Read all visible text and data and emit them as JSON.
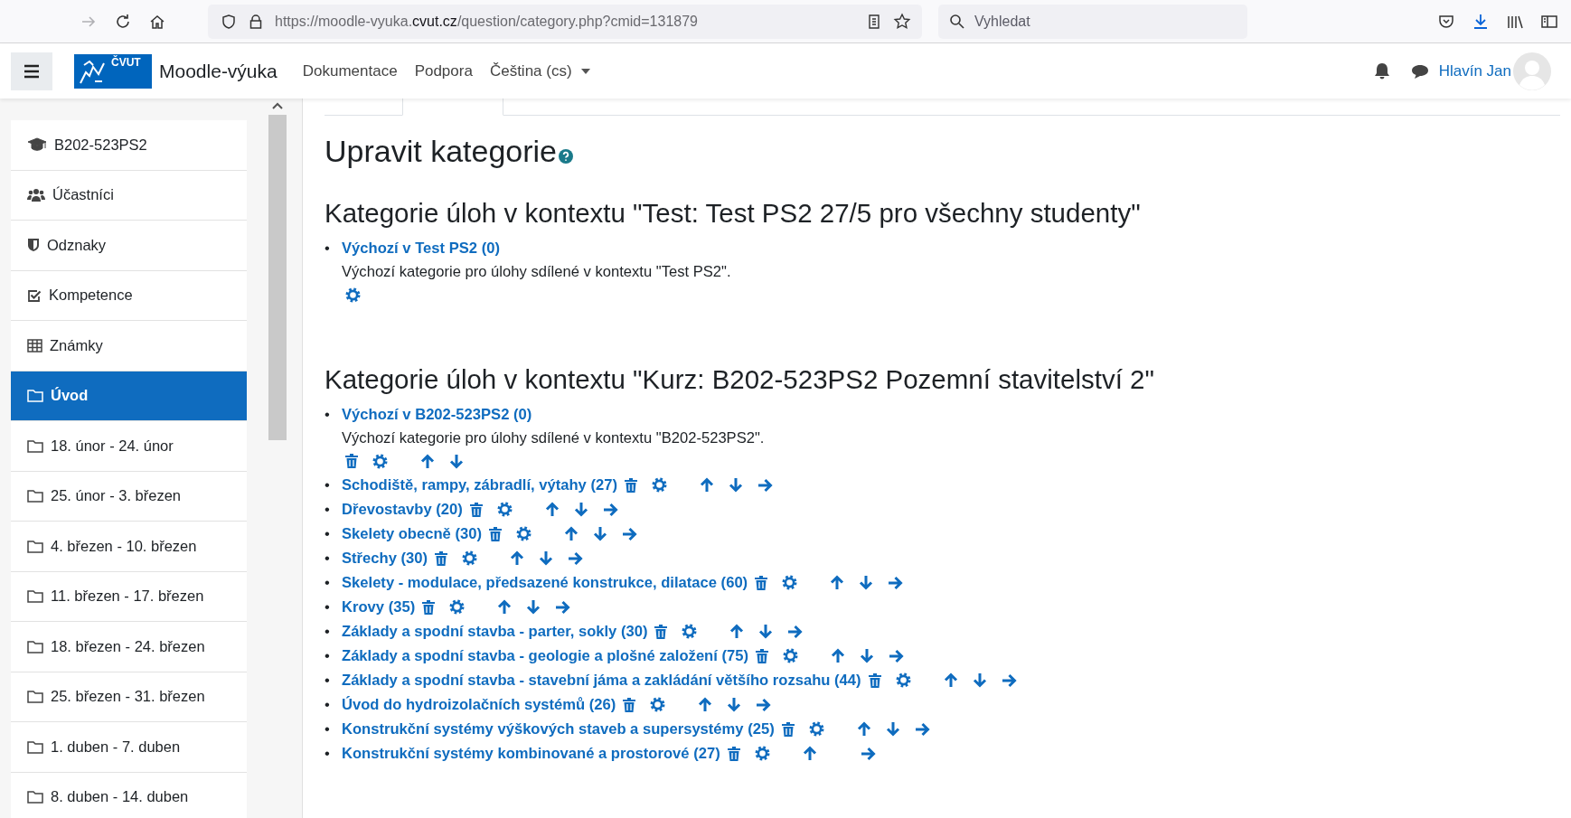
{
  "browser": {
    "url": {
      "prefix": "https://moodle-vyuka.",
      "domain": "cvut.cz",
      "path": "/question/category.php?cmid=131879"
    },
    "search": {
      "placeholder": "Vyhledat"
    }
  },
  "navbar": {
    "logo": "ČVUT",
    "site_name": "Moodle-výuka",
    "links": [
      {
        "label": "Dokumentace",
        "kind": "link"
      },
      {
        "label": "Podpora",
        "kind": "link"
      },
      {
        "label": "Čeština (cs)",
        "kind": "dropdown"
      }
    ],
    "user": "Hlavín Jan"
  },
  "sidebar": {
    "items": [
      {
        "label": "B202-523PS2",
        "kind": "course",
        "selected": false
      },
      {
        "label": "Účastníci",
        "kind": "users",
        "selected": false
      },
      {
        "label": "Odznaky",
        "kind": "badges",
        "selected": false
      },
      {
        "label": "Kompetence",
        "kind": "competencies",
        "selected": false
      },
      {
        "label": "Známky",
        "kind": "grades",
        "selected": false
      },
      {
        "label": "Úvod",
        "kind": "section",
        "selected": true
      },
      {
        "label": "18. únor - 24. únor",
        "kind": "section",
        "selected": false
      },
      {
        "label": "25. únor - 3. březen",
        "kind": "section",
        "selected": false
      },
      {
        "label": "4. březen - 10. březen",
        "kind": "section",
        "selected": false
      },
      {
        "label": "11. březen - 17. březen",
        "kind": "section",
        "selected": false
      },
      {
        "label": "18. březen - 24. březen",
        "kind": "section",
        "selected": false
      },
      {
        "label": "25. březen - 31. březen",
        "kind": "section",
        "selected": false
      },
      {
        "label": "1. duben - 7. duben",
        "kind": "section",
        "selected": false
      },
      {
        "label": "8. duben - 14. duben",
        "kind": "section",
        "selected": false
      }
    ]
  },
  "bullet": "•",
  "page": {
    "title": "Upravit kategorie",
    "sections": [
      {
        "heading": "Kategorie úloh v kontextu \"Test: Test PS2 27/5 pro všechny studenty\"",
        "categories": [
          {
            "label": "Výchozí v Test PS2 (0)",
            "description": "Výchozí kategorie pro úlohy sdílené v kontextu \"Test PS2\".",
            "delete": false,
            "edit": true,
            "up": false,
            "down": false,
            "right": false
          }
        ]
      },
      {
        "heading": "Kategorie úloh v kontextu \"Kurz: B202-523PS2 Pozemní stavitelství 2\"",
        "categories": [
          {
            "label": "Výchozí v B202-523PS2 (0)",
            "description": "Výchozí kategorie pro úlohy sdílené v kontextu \"B202-523PS2\".",
            "delete": true,
            "edit": true,
            "up": true,
            "down": true,
            "right": false
          },
          {
            "label": "Schodiště, rampy, zábradlí, výtahy (27)",
            "delete": true,
            "edit": true,
            "up": true,
            "down": true,
            "right": true
          },
          {
            "label": "Dřevostavby (20)",
            "delete": true,
            "edit": true,
            "up": true,
            "down": true,
            "right": true
          },
          {
            "label": "Skelety obecně (30)",
            "delete": true,
            "edit": true,
            "up": true,
            "down": true,
            "right": true
          },
          {
            "label": "Střechy (30)",
            "delete": true,
            "edit": true,
            "up": true,
            "down": true,
            "right": true
          },
          {
            "label": "Skelety - modulace, předsazené konstrukce, dilatace (60)",
            "delete": true,
            "edit": true,
            "up": true,
            "down": true,
            "right": true
          },
          {
            "label": "Krovy (35)",
            "delete": true,
            "edit": true,
            "up": true,
            "down": true,
            "right": true
          },
          {
            "label": "Základy a spodní stavba - parter, sokly (30)",
            "delete": true,
            "edit": true,
            "up": true,
            "down": true,
            "right": true
          },
          {
            "label": "Základy a spodní stavba - geologie a plošné založení (75)",
            "delete": true,
            "edit": true,
            "up": true,
            "down": true,
            "right": true
          },
          {
            "label": "Základy a spodní stavba - stavební jáma a zakládání většího rozsahu (44)",
            "delete": true,
            "edit": true,
            "up": true,
            "down": true,
            "right": true
          },
          {
            "label": "Úvod do hydroizolačních systémů (26)",
            "delete": true,
            "edit": true,
            "up": true,
            "down": true,
            "right": true
          },
          {
            "label": "Konstrukční systémy výškových staveb a supersystémy (25)",
            "delete": true,
            "edit": true,
            "up": true,
            "down": true,
            "right": true
          },
          {
            "label": "Konstrukční systémy kombinované a prostorové (27)",
            "delete": true,
            "edit": true,
            "up": true,
            "down": false,
            "right": true
          }
        ]
      }
    ]
  }
}
